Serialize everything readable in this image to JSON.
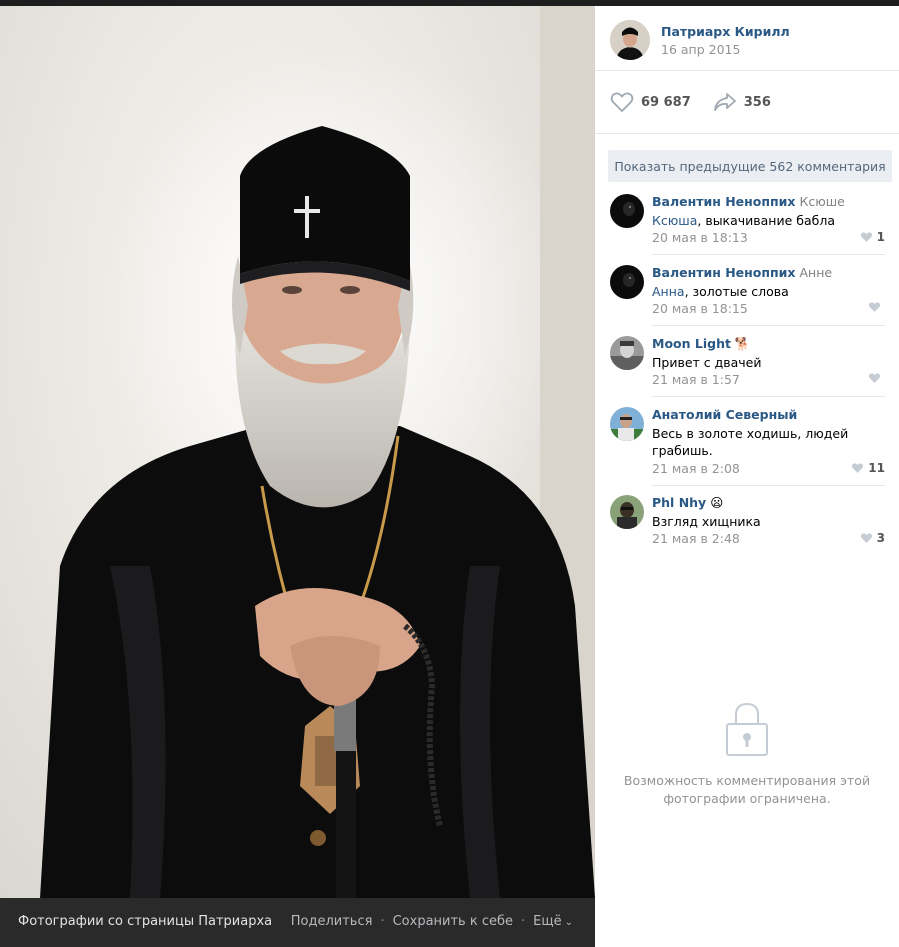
{
  "album": {
    "title": "Фотографии со страницы Патриарха"
  },
  "photo_actions": {
    "share": "Поделиться",
    "save": "Сохранить к себе",
    "more": "Ещё"
  },
  "author": {
    "name": "Патриарх Кирилл",
    "date": "16 апр 2015"
  },
  "stats": {
    "likes": "69 687",
    "shares": "356"
  },
  "show_previous": "Показать предыдущие 562 комментария",
  "comments": [
    {
      "name": "Валентин Неноппих",
      "reply_to": "Ксюше",
      "address": "Ксюша",
      "text": ", выкачивание бабла",
      "date": "20 мая в 18:13",
      "likes": "1"
    },
    {
      "name": "Валентин Неноппих",
      "reply_to": "Анне",
      "address": "Анна",
      "text": ", золотые слова",
      "date": "20 мая в 18:15",
      "likes": ""
    },
    {
      "name": "Moon Light",
      "emoji": "🐕",
      "reply_to": "",
      "address": "",
      "text": "Привет с двачей",
      "date": "21 мая в 1:57",
      "likes": ""
    },
    {
      "name": "Анатолий Северный",
      "reply_to": "",
      "address": "",
      "text": "Весь в золоте ходишь, людей грабишь.",
      "date": "21 мая в 2:08",
      "likes": "11"
    },
    {
      "name": "Phl Nhy",
      "emoji": "😦",
      "reply_to": "",
      "address": "",
      "text": "Взгляд хищника",
      "date": "21 мая в 2:48",
      "likes": "3"
    }
  ],
  "restriction": {
    "line1": "Возможность комментирования этой",
    "line2": "фотографии ограничена."
  },
  "colors": {
    "link": "#2a5885",
    "muted": "#939393",
    "footer_bg": "#2a2a2b"
  }
}
